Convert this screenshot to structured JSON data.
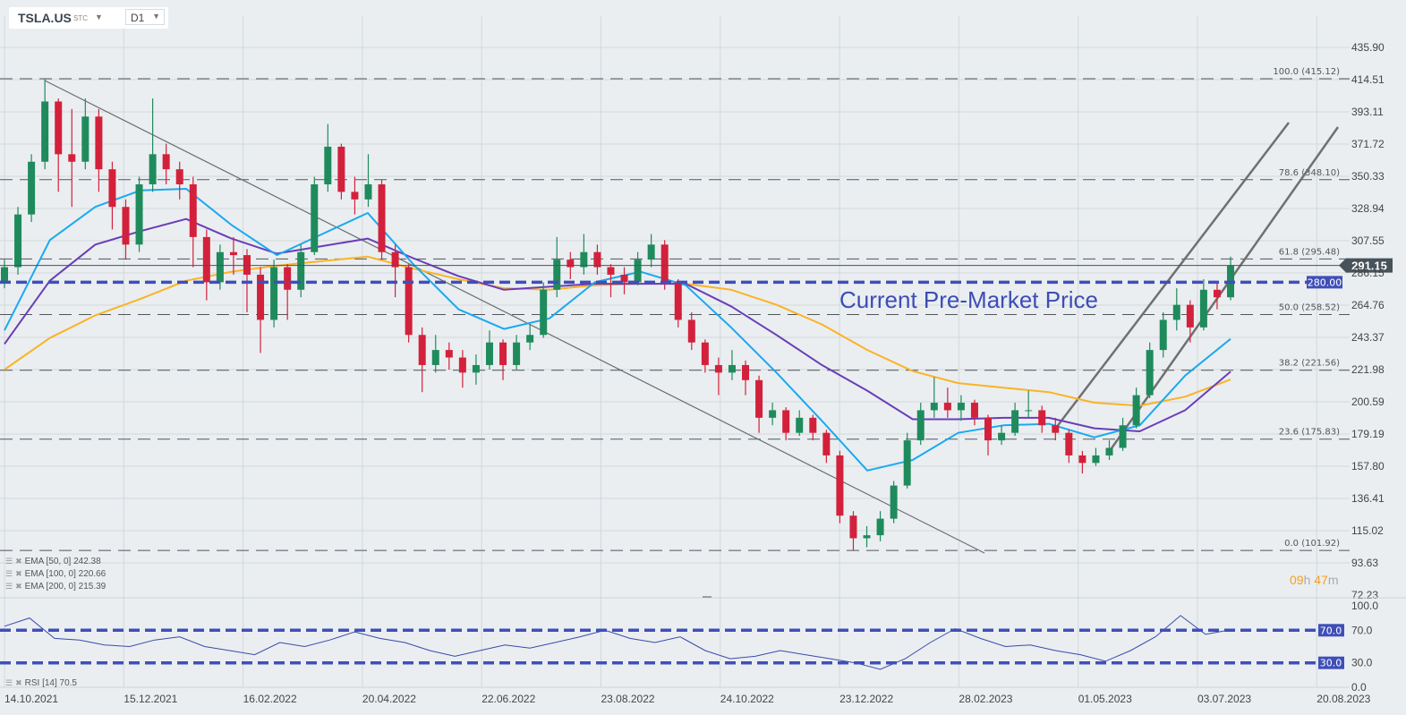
{
  "header": {
    "symbol": "TSLA.US",
    "exchange": "STC",
    "timeframe": "D1"
  },
  "annotation": "Current Pre-Market Price",
  "countdown": {
    "hours": "09",
    "h": "h",
    "minutes": "47",
    "m": "m"
  },
  "legend": [
    {
      "label": "EMA [50, 0] 242.38",
      "color": "#1aa9f0"
    },
    {
      "label": "EMA [100, 0] 220.66",
      "color": "#6a3db8"
    },
    {
      "label": "EMA [200, 0] 215.39",
      "color": "#fbb324"
    }
  ],
  "rsi_legend": "RSI [14] 70.5",
  "colors": {
    "up": "#1f8b5c",
    "down": "#d3213b",
    "ema50": "#1aa9f0",
    "ema100": "#6a3db8",
    "ema200": "#fbb324",
    "level": "#3f4fb8",
    "current": "#47525b"
  },
  "chart_data": {
    "type": "candlestick",
    "symbol": "TSLA.US",
    "price_ticks": [
      "435.90",
      "414.51",
      "393.11",
      "371.72",
      "350.33",
      "328.94",
      "307.55",
      "286.15",
      "264.76",
      "243.37",
      "221.98",
      "200.59",
      "179.19",
      "157.80",
      "136.41",
      "115.02",
      "93.63",
      "72.23"
    ],
    "date_ticks": [
      "14.10.2021",
      "15.12.2021",
      "16.02.2022",
      "20.04.2022",
      "22.06.2022",
      "23.08.2022",
      "24.10.2022",
      "23.12.2022",
      "28.02.2023",
      "01.05.2023",
      "03.07.2023",
      "20.08.2023"
    ],
    "candles": [
      [
        280,
        295,
        276,
        290
      ],
      [
        290,
        330,
        285,
        325
      ],
      [
        325,
        365,
        320,
        360
      ],
      [
        360,
        415,
        355,
        400
      ],
      [
        400,
        402,
        340,
        365
      ],
      [
        365,
        395,
        330,
        360
      ],
      [
        360,
        402,
        355,
        390
      ],
      [
        390,
        395,
        340,
        355
      ],
      [
        355,
        360,
        315,
        330
      ],
      [
        330,
        335,
        295,
        305
      ],
      [
        305,
        350,
        300,
        345
      ],
      [
        345,
        402,
        340,
        365
      ],
      [
        365,
        372,
        345,
        355
      ],
      [
        355,
        360,
        335,
        345
      ],
      [
        345,
        350,
        290,
        310
      ],
      [
        310,
        315,
        268,
        280
      ],
      [
        280,
        305,
        275,
        300
      ],
      [
        300,
        310,
        285,
        298
      ],
      [
        298,
        302,
        260,
        285
      ],
      [
        285,
        290,
        233,
        255
      ],
      [
        255,
        295,
        250,
        290
      ],
      [
        290,
        292,
        255,
        275
      ],
      [
        275,
        305,
        270,
        300
      ],
      [
        300,
        350,
        298,
        345
      ],
      [
        345,
        385,
        340,
        370
      ],
      [
        370,
        372,
        335,
        340
      ],
      [
        340,
        350,
        325,
        335
      ],
      [
        335,
        365,
        330,
        345
      ],
      [
        345,
        348,
        295,
        300
      ],
      [
        300,
        305,
        270,
        290
      ],
      [
        290,
        292,
        240,
        245
      ],
      [
        245,
        250,
        207,
        225
      ],
      [
        225,
        245,
        220,
        235
      ],
      [
        235,
        240,
        222,
        230
      ],
      [
        230,
        235,
        210,
        220
      ],
      [
        220,
        232,
        212,
        225
      ],
      [
        225,
        248,
        222,
        240
      ],
      [
        240,
        242,
        215,
        225
      ],
      [
        225,
        245,
        222,
        240
      ],
      [
        240,
        252,
        235,
        245
      ],
      [
        245,
        280,
        243,
        275
      ],
      [
        275,
        310,
        270,
        295
      ],
      [
        295,
        300,
        282,
        290
      ],
      [
        290,
        312,
        285,
        300
      ],
      [
        300,
        305,
        285,
        290
      ],
      [
        290,
        292,
        270,
        285
      ],
      [
        285,
        290,
        272,
        280
      ],
      [
        280,
        300,
        278,
        295
      ],
      [
        295,
        312,
        290,
        305
      ],
      [
        305,
        308,
        275,
        280
      ],
      [
        280,
        282,
        250,
        255
      ],
      [
        255,
        260,
        235,
        240
      ],
      [
        240,
        242,
        220,
        225
      ],
      [
        225,
        230,
        205,
        220
      ],
      [
        220,
        235,
        215,
        225
      ],
      [
        225,
        228,
        205,
        215
      ],
      [
        215,
        218,
        180,
        190
      ],
      [
        190,
        200,
        185,
        195
      ],
      [
        195,
        197,
        175,
        180
      ],
      [
        180,
        195,
        178,
        190
      ],
      [
        190,
        192,
        175,
        180
      ],
      [
        180,
        182,
        160,
        165
      ],
      [
        165,
        168,
        120,
        125
      ],
      [
        125,
        128,
        102,
        110
      ],
      [
        110,
        118,
        104,
        112
      ],
      [
        112,
        128,
        108,
        123
      ],
      [
        123,
        148,
        120,
        145
      ],
      [
        145,
        180,
        143,
        175
      ],
      [
        175,
        200,
        172,
        195
      ],
      [
        195,
        217,
        190,
        200
      ],
      [
        200,
        210,
        190,
        195
      ],
      [
        195,
        205,
        188,
        200
      ],
      [
        200,
        202,
        185,
        190
      ],
      [
        190,
        192,
        165,
        175
      ],
      [
        175,
        185,
        172,
        180
      ],
      [
        180,
        200,
        178,
        195
      ],
      [
        195,
        208,
        190,
        195
      ],
      [
        195,
        198,
        180,
        185
      ],
      [
        185,
        190,
        175,
        180
      ],
      [
        180,
        182,
        160,
        165
      ],
      [
        165,
        168,
        153,
        160
      ],
      [
        160,
        170,
        158,
        165
      ],
      [
        165,
        175,
        162,
        170
      ],
      [
        170,
        190,
        168,
        185
      ],
      [
        185,
        210,
        183,
        205
      ],
      [
        205,
        240,
        203,
        235
      ],
      [
        235,
        260,
        230,
        255
      ],
      [
        255,
        276,
        248,
        265
      ],
      [
        265,
        268,
        240,
        250
      ],
      [
        250,
        282,
        248,
        275
      ],
      [
        275,
        280,
        262,
        270
      ],
      [
        270,
        297,
        268,
        291.15
      ]
    ],
    "ema50": [
      248,
      308,
      330,
      341,
      342,
      318,
      298,
      312,
      326,
      292,
      262,
      249,
      256,
      280,
      287,
      278,
      250,
      220,
      188,
      155,
      162,
      180,
      185,
      186,
      177,
      185,
      218,
      242.38
    ],
    "ema100": [
      239,
      281,
      305,
      314,
      322,
      309,
      299,
      304,
      309,
      296,
      284,
      275,
      277,
      279,
      279,
      279,
      264,
      245,
      225,
      208,
      189,
      189,
      190,
      190,
      183,
      181,
      195,
      220.66
    ],
    "ema200": [
      222,
      243,
      258,
      269,
      281,
      287,
      291,
      294,
      297,
      289,
      282,
      276,
      275,
      278,
      279,
      279,
      275,
      265,
      252,
      235,
      221,
      213,
      210,
      207,
      200,
      198,
      204,
      215.39
    ],
    "fib_levels": [
      {
        "label": "100.0 (415.12)",
        "value": 415.12
      },
      {
        "label": "78.6 (348.10)",
        "value": 348.1
      },
      {
        "label": "61.8 (295.48)",
        "value": 295.48
      },
      {
        "label": "50.0 (258.52)",
        "value": 258.52
      },
      {
        "label": "38.2 (221.56)",
        "value": 221.56
      },
      {
        "label": "23.6 (175.83)",
        "value": 175.83
      },
      {
        "label": "0.0 (101.92)",
        "value": 101.92
      }
    ],
    "level_line": {
      "value": 280.0,
      "label": "280.00"
    },
    "current_price": {
      "value": 291.15,
      "label": "291.15"
    },
    "rsi": {
      "values": [
        75,
        85,
        60,
        58,
        52,
        50,
        58,
        62,
        50,
        45,
        40,
        55,
        50,
        58,
        68,
        60,
        55,
        45,
        38,
        45,
        52,
        48,
        55,
        62,
        70,
        60,
        55,
        62,
        45,
        35,
        38,
        45,
        40,
        35,
        30,
        22,
        35,
        55,
        72,
        60,
        50,
        52,
        45,
        40,
        32,
        45,
        62,
        88,
        65,
        70.5
      ],
      "ticks": [
        "100.0",
        "70.0",
        "30.0",
        "0.0"
      ],
      "levels": [
        {
          "value": 70,
          "label": "70.0"
        },
        {
          "value": 30,
          "label": "30.0"
        }
      ]
    }
  }
}
